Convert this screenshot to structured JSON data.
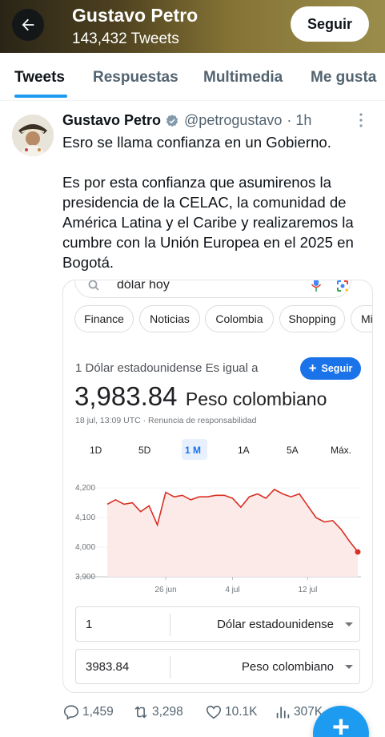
{
  "header": {
    "name": "Gustavo Petro",
    "tweet_count": "143,432 Tweets",
    "follow_label": "Seguir"
  },
  "tabs": [
    {
      "label": "Tweets",
      "active": true
    },
    {
      "label": "Respuestas"
    },
    {
      "label": "Multimedia"
    },
    {
      "label": "Me gusta"
    }
  ],
  "tweet": {
    "name": "Gustavo Petro",
    "handle": "@petrogustavo",
    "time": "· 1h",
    "line1": "Esro se llama confianza en un Gobierno.",
    "line2": "Es por esta confianza que asumirenos la presidencia de la CELAC, la comunidad de América Latina y el Caribe y realizaremos la cumbre con la Unión Europea en el 2025 en Bogotá."
  },
  "google": {
    "query": "dólar hoy",
    "chips": [
      "Finance",
      "Noticias",
      "Colombia",
      "Shopping",
      "Mi"
    ],
    "conversion_label": "1 Dólar estadounidense Es igual a",
    "follow_label": "Seguir",
    "rate_value": "3,983.84",
    "rate_currency": "Peso colombiano",
    "timestamp": "18 jul, 13:09 UTC · Renuncia de responsabilidad",
    "ranges": [
      "1D",
      "5D",
      "1 M",
      "1A",
      "5A",
      "Máx."
    ],
    "active_range": "1 M",
    "from": {
      "amount": "1",
      "currency": "Dólar estadounidense"
    },
    "to": {
      "amount": "3983.84",
      "currency": "Peso colombiano"
    }
  },
  "chart_data": {
    "type": "area",
    "yticks": [
      "4,200",
      "4,100",
      "4,000",
      "3,900"
    ],
    "ytick_values": [
      4200,
      4100,
      4000,
      3900
    ],
    "xticks": [
      "26 jun",
      "4 jul",
      "12 jul"
    ],
    "ylim": [
      3900,
      4230
    ],
    "values": [
      4145,
      4160,
      4145,
      4150,
      4120,
      4140,
      4075,
      4185,
      4170,
      4175,
      4160,
      4170,
      4170,
      4175,
      4175,
      4165,
      4135,
      4170,
      4180,
      4165,
      4195,
      4180,
      4170,
      4180,
      4140,
      4100,
      4085,
      4090,
      4060,
      4020,
      3984
    ],
    "line_color": "#d93025",
    "fill_color": "#fce8e6"
  },
  "actions": {
    "replies": "1,459",
    "retweets": "3,298",
    "likes": "10.1K",
    "views": "307K"
  },
  "colors": {
    "accent": "#1d9bf0",
    "google_blue": "#1a73e8"
  }
}
